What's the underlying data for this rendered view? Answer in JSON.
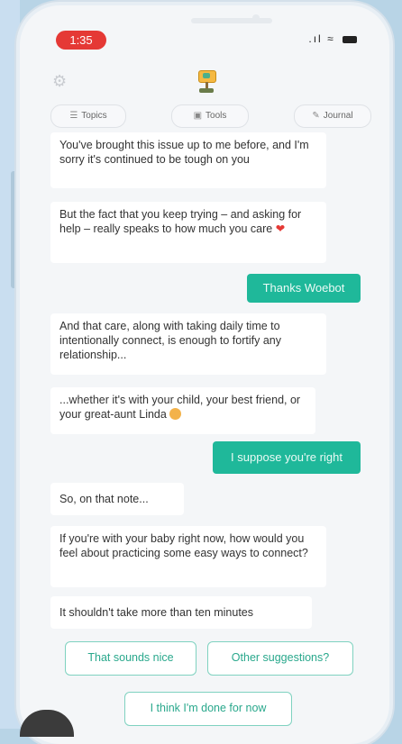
{
  "status": {
    "time": "1:35",
    "signal": ".ıl",
    "wifi": "≈"
  },
  "header": {
    "settings_icon": "gear-icon",
    "logo_icon": "woebot-logo"
  },
  "tabs": [
    {
      "label": "Topics",
      "icon": "list-icon"
    },
    {
      "label": "Tools",
      "icon": "toolbox-icon"
    },
    {
      "label": "Journal",
      "icon": "journal-icon"
    }
  ],
  "messages": {
    "bot1": "You've brought this issue up to me before, and I'm sorry it's continued to be tough on you",
    "bot2": "But the fact that you keep trying – and asking for help – really speaks to how much you care",
    "bot2_emoji": "❤",
    "user1": "Thanks Woebot",
    "bot3": "And that care, along with taking daily time to intentionally connect, is enough to fortify any relationship...",
    "bot4": "...whether it's with your child, your best friend, or your great-aunt Linda",
    "user2": "I suppose you're right",
    "bot5": "So, on that note...",
    "bot6": "If you're with your baby right now, how would you feel about practicing some easy ways to connect?",
    "bot7": "It shouldn't take more than ten minutes"
  },
  "replies": {
    "option1": "That sounds nice",
    "option2": "Other suggestions?",
    "option3": "I think I'm done for now"
  },
  "colors": {
    "accent": "#1fb89a",
    "reply_border": "#7fd2c0",
    "time_pill": "#e53935",
    "background": "#b8d4e6"
  }
}
